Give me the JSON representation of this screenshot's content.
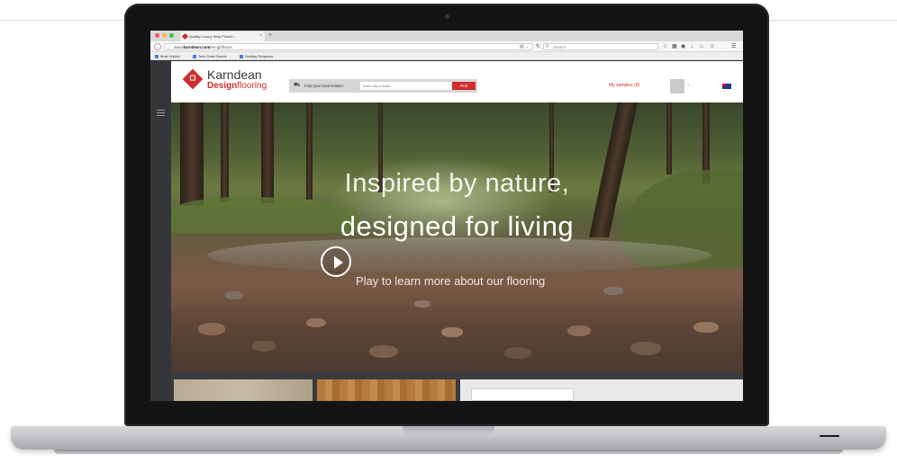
{
  "browser": {
    "tab_title": "Quality Luxury Vinyl Floorin...",
    "tab_close": "×",
    "new_tab": "+",
    "url_prefix": "www.",
    "url_domain": "karndean.com",
    "url_path": "/en-gb/floors",
    "search_placeholder": "Search",
    "bookmarks": [
      "Most Visited",
      "Tech Data Sheets",
      "Holiday Requests"
    ]
  },
  "header": {
    "logo_main": "Karndean",
    "logo_sub_bold": "Design",
    "logo_sub_rest": "flooring",
    "retailer_label": "Find your local retailer",
    "retailer_placeholder": "enter city or town",
    "find_button": "Find",
    "samples_link": "My samples (0)"
  },
  "hero": {
    "line1": "Inspired by nature,",
    "line2": "designed for living",
    "play_caption": "Play to learn more about our flooring"
  },
  "icons": {
    "back": "back-arrow-icon",
    "reload": "reload-icon",
    "search": "search-icon",
    "play": "play-icon",
    "menu": "hamburger-menu-icon",
    "van": "delivery-van-icon",
    "flag": "australia-flag-icon"
  },
  "colors": {
    "brand_red": "#d02c2c",
    "sidebar": "#35363a",
    "header_bg": "#ffffff"
  }
}
